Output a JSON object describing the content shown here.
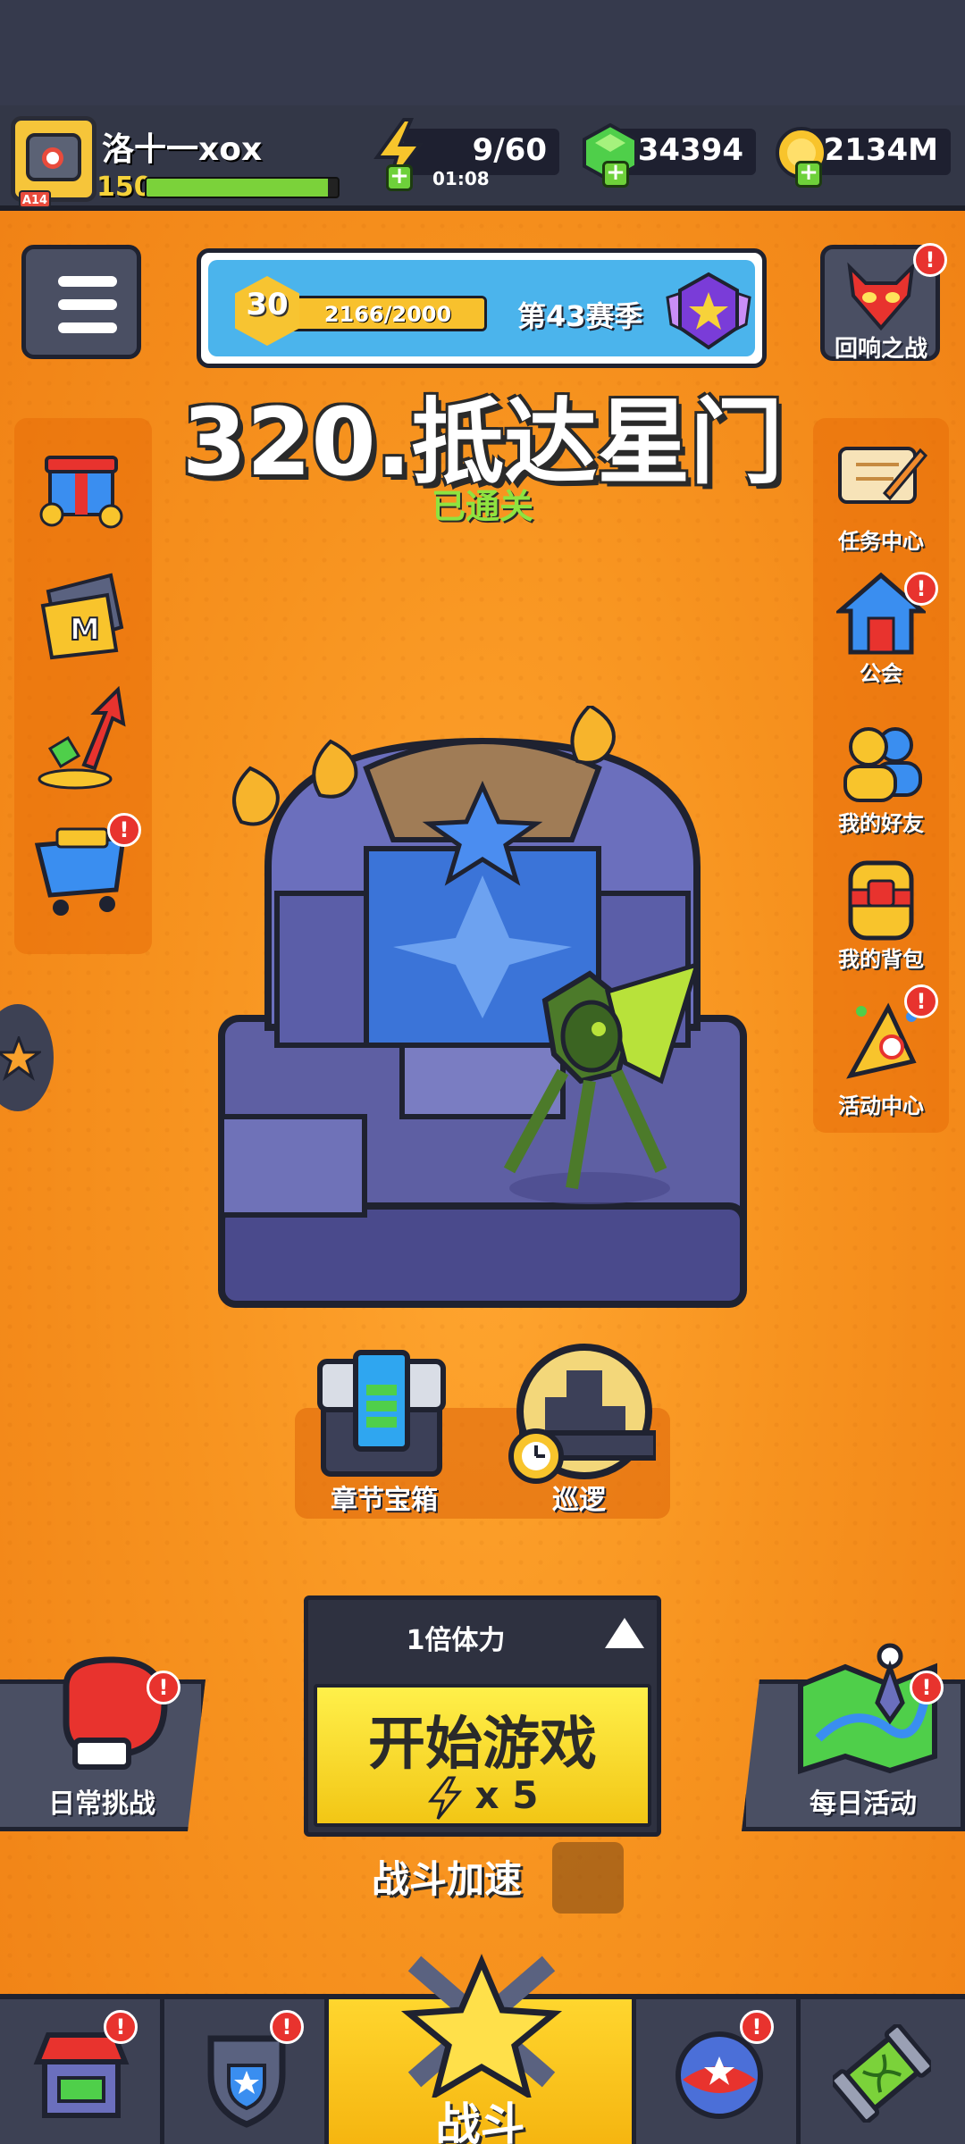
{
  "player": {
    "name": "洛十一xox",
    "level": "150",
    "avatar_badge": "A14",
    "xp_fraction": 0.95
  },
  "resources": {
    "energy": {
      "value": "9/60",
      "timer": "01:08"
    },
    "gems": {
      "value": "34394"
    },
    "coins": {
      "value": "2134M"
    }
  },
  "season": {
    "rank": "30",
    "progress": "2166/2000",
    "name": "第43赛季"
  },
  "top_right": {
    "label": "回响之战",
    "badge": "!"
  },
  "stage": {
    "title": "320.抵达星门",
    "status": "已通关"
  },
  "left_panel": {
    "items": [
      {
        "name": "gift-icon"
      },
      {
        "name": "card-icon"
      },
      {
        "name": "growth-icon"
      },
      {
        "name": "shop-cart-icon",
        "badge": "!"
      }
    ]
  },
  "right_panel": {
    "items": [
      {
        "label": "任务中心"
      },
      {
        "label": "公会",
        "badge": "!"
      },
      {
        "label": "我的好友"
      },
      {
        "label": "我的背包"
      },
      {
        "label": "活动中心",
        "badge": "!"
      }
    ]
  },
  "chapter": {
    "chest_label": "章节宝箱",
    "patrol_label": "巡逻"
  },
  "start": {
    "multiplier": "1倍体力",
    "label": "开始游戏",
    "cost": "x 5"
  },
  "speed": {
    "label": "战斗加速"
  },
  "daily_challenge": {
    "label": "日常挑战",
    "badge": "!"
  },
  "daily_event": {
    "label": "每日活动",
    "badge": "!"
  },
  "nav": {
    "battle_label": "战斗"
  },
  "colors": {
    "accent": "#f7931f",
    "button": "#f2c615",
    "panel": "#4a4f63",
    "badge": "#e8332e"
  }
}
